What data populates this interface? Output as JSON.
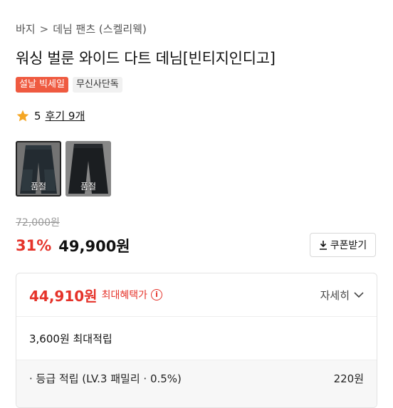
{
  "breadcrumb": {
    "category": "바지",
    "subcategory": "데님 팬츠 (스켈리웩)"
  },
  "product": {
    "title": "워싱 벌룬 와이드 다트 데님[빈티지인디고]",
    "badges": [
      "설날 빅세일",
      "무신사단독"
    ],
    "rating": "5",
    "reviews": "후기 9개"
  },
  "thumbnails": [
    {
      "label": "품절",
      "selected": true
    },
    {
      "label": "품절",
      "selected": false
    }
  ],
  "pricing": {
    "original": "72,000원",
    "discount": "31%",
    "price": "49,900원",
    "coupon_label": "쿠폰받기"
  },
  "benefit": {
    "price": "44,910원",
    "label": "최대혜택가",
    "detail_label": "자세히",
    "points": "3,600원 최대적립",
    "rows": [
      {
        "label": "· 등급 적립 (LV.3 패밀리 · 0.5%)",
        "value": "220원"
      }
    ]
  },
  "colors": {
    "accent": "#e5332a",
    "sale_badge": "#ef5a40",
    "star": "#f5a623"
  }
}
